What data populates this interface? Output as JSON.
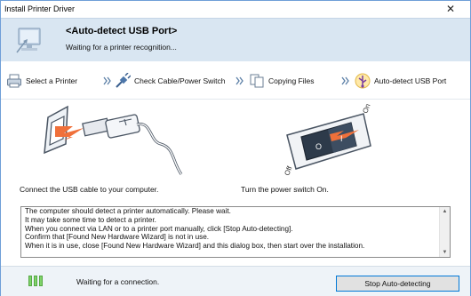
{
  "window": {
    "title": "Install Printer Driver",
    "close_glyph": "✕"
  },
  "header": {
    "title": "<Auto-detect USB Port>",
    "subtitle": "Waiting for a printer recognition...",
    "icon": "usb-computer-icon"
  },
  "steps": [
    {
      "label": "Select a Printer",
      "icon": "printer-icon"
    },
    {
      "label": "Check Cable/Power Switch",
      "icon": "plug-icon"
    },
    {
      "label": "Copying Files",
      "icon": "copy-files-icon"
    },
    {
      "label": "Auto-detect USB Port",
      "icon": "usb-icon",
      "active": true
    }
  ],
  "illustrations": {
    "left_caption": "Connect the USB cable to your computer.",
    "right_caption": "Turn the power switch On.",
    "switch_on_label": "On",
    "switch_off_label": "Off",
    "switch_on_mark": "I",
    "switch_off_mark": "O"
  },
  "message_lines": [
    "The computer should detect a printer automatically. Please wait.",
    "It may take some time to detect a printer.",
    "When you connect via LAN or to a printer port manually, click [Stop Auto-detecting].",
    "Confirm that [Found New Hardware Wizard] is not in use.",
    "When it is in use, close [Found New Hardware Wizard] and this dialog box, then start over the installation."
  ],
  "footer": {
    "status": "Waiting for a connection.",
    "stop_button": "Stop Auto-detecting",
    "led_color": "#7fd36a"
  },
  "colors": {
    "header_bg": "#d9e6f2",
    "accent_arrow": "#f0703a",
    "border": "#6f9fd8"
  }
}
